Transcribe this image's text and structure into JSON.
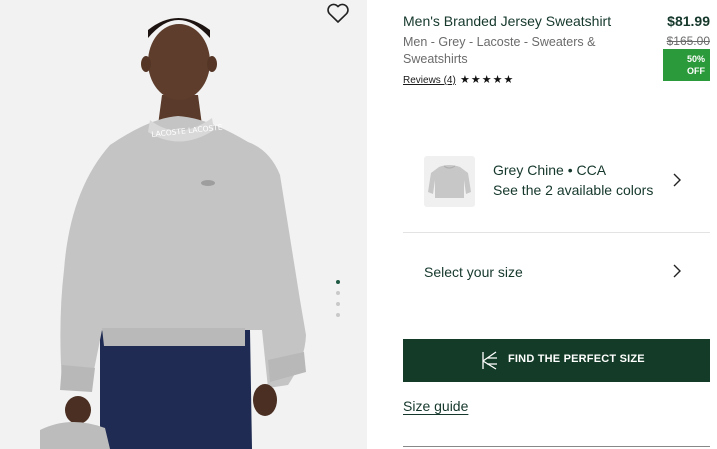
{
  "product": {
    "title": "Men's Branded Jersey Sweatshirt",
    "subtitle": "Men - Grey - Lacoste - Sweaters & Sweatshirts",
    "reviews_label": "Reviews (4)",
    "rating_stars": "★★★★★",
    "rating": 5,
    "price": "$81.99",
    "original_price": "$165.00",
    "discount_line1": "50%",
    "discount_line2": "OFF"
  },
  "image": {
    "collar_text": "LACOSTE LACOSTE",
    "gallery_dots": 4,
    "active_dot": 1
  },
  "color": {
    "name": "Grey Chine • CCA",
    "count_label": "See the 2 available colors"
  },
  "size": {
    "select_label": "Select your size",
    "find_button": "FIND THE PERFECT SIZE",
    "guide_link": "Size guide"
  },
  "icons": {
    "wishlist": "heart-outline-icon",
    "chevron": "chevron-right-icon",
    "fit": "fit-finder-icon"
  },
  "colors": {
    "brand_dark": "#133b27",
    "text_green": "#15382b",
    "discount_green": "#2b9a3a"
  }
}
